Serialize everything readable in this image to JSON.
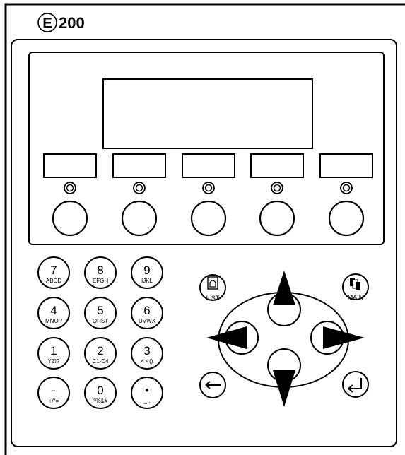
{
  "brand": {
    "logo_letter": "E",
    "model": "200"
  },
  "softkeys": [
    {
      "id": "f1"
    },
    {
      "id": "f2"
    },
    {
      "id": "f3"
    },
    {
      "id": "f4"
    },
    {
      "id": "f5"
    }
  ],
  "keypad": {
    "keys": [
      {
        "main": "7",
        "sub": "ABCD"
      },
      {
        "main": "8",
        "sub": "EFGH"
      },
      {
        "main": "9",
        "sub": "IJKL"
      },
      {
        "main": "4",
        "sub": "MNOP"
      },
      {
        "main": "5",
        "sub": "QRST"
      },
      {
        "main": "6",
        "sub": "UVWX"
      },
      {
        "main": "1",
        "sub": "YZ!?"
      },
      {
        "main": "2",
        "sub": "C1-C4"
      },
      {
        "main": "3",
        "sub": "<> ()"
      },
      {
        "main": "-",
        "sub": "+/*="
      },
      {
        "main": "0",
        "sub": "°%&#"
      },
      {
        "main": "•",
        "sub": "_ ."
      }
    ]
  },
  "nav": {
    "list_label": "L ST",
    "main_label": "MAIN"
  },
  "icons": {
    "list": "alarm-list-icon",
    "main": "pages-icon",
    "back": "arrow-left-icon",
    "enter": "enter-icon"
  }
}
